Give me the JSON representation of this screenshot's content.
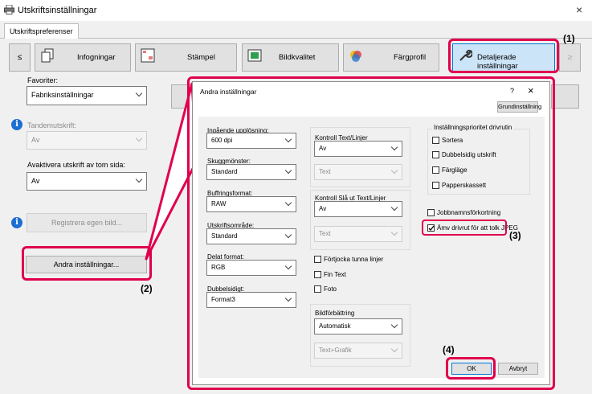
{
  "window": {
    "title": "Utskriftsinställningar",
    "close": "×"
  },
  "tabs": {
    "active": "Utskriftspreferenser"
  },
  "toolbar": {
    "prev": "≤",
    "items": [
      "Infogningar",
      "Stämpel",
      "Bildkvalitet",
      "Färgprofil",
      "Detaljerade inställningar"
    ],
    "next": "≥"
  },
  "left": {
    "favorites_label": "Favoriter:",
    "favorites_value": "Fabriksinställningar",
    "tandem_label": "Tandemutskrift:",
    "tandem_value": "Av",
    "blank_label": "Avaktivera utskrift av tom sida:",
    "blank_value": "Av",
    "register_button": "Registrera egen bild...",
    "other_settings_button": "Andra inställningar..."
  },
  "dialog": {
    "title": "Andra inställningar",
    "help": "?",
    "close": "×",
    "default_button": "Grundinställning",
    "col1": {
      "resolution_label": "Ingående upplösning:",
      "resolution_value": "600 dpi",
      "shading_label": "Skuggmönster:",
      "shading_value": "Standard",
      "buffering_label": "Buffringsformat:",
      "buffering_value": "RAW",
      "print_area_label": "Utskriftsområde:",
      "print_area_value": "Standard",
      "divided_label": "Delat format:",
      "divided_value": "RGB",
      "duplex_label": "Dubbelsidigt:",
      "duplex_value": "Format3"
    },
    "col2": {
      "text_lines_label": "Kontroll Text/Linjer",
      "text_lines_value": "Av",
      "text_lines_sub": "Text",
      "black_label": "Kontroll Slå ut Text/Linjer",
      "black_value": "Av",
      "black_sub": "Text",
      "thicken_label": "Förtjocka tunna linjer",
      "fine_text_label": "Fin Text",
      "photo_label": "Foto",
      "enhance_label": "Bildförbättring",
      "enhance_value": "Automatisk",
      "enhance_sub": "Text+Grafik"
    },
    "col3": {
      "priority_label": "Inställningsprioritet drivrutin",
      "sort_label": "Sortera",
      "duplex_label": "Dubbelsidig utskrift",
      "color_label": "Färgläge",
      "paper_label": "Papperskassett",
      "job_label": "Jobbnamnsförkortning",
      "jpeg_label": "Ämv drivrut för att tolk JPEG"
    },
    "ok": "OK",
    "cancel": "Avbryt"
  },
  "callouts": {
    "c1": "(1)",
    "c2": "(2)",
    "c3": "(3)",
    "c4": "(4)"
  },
  "colors": {
    "highlight": "#e0004d",
    "info": "#1c6fd1"
  }
}
